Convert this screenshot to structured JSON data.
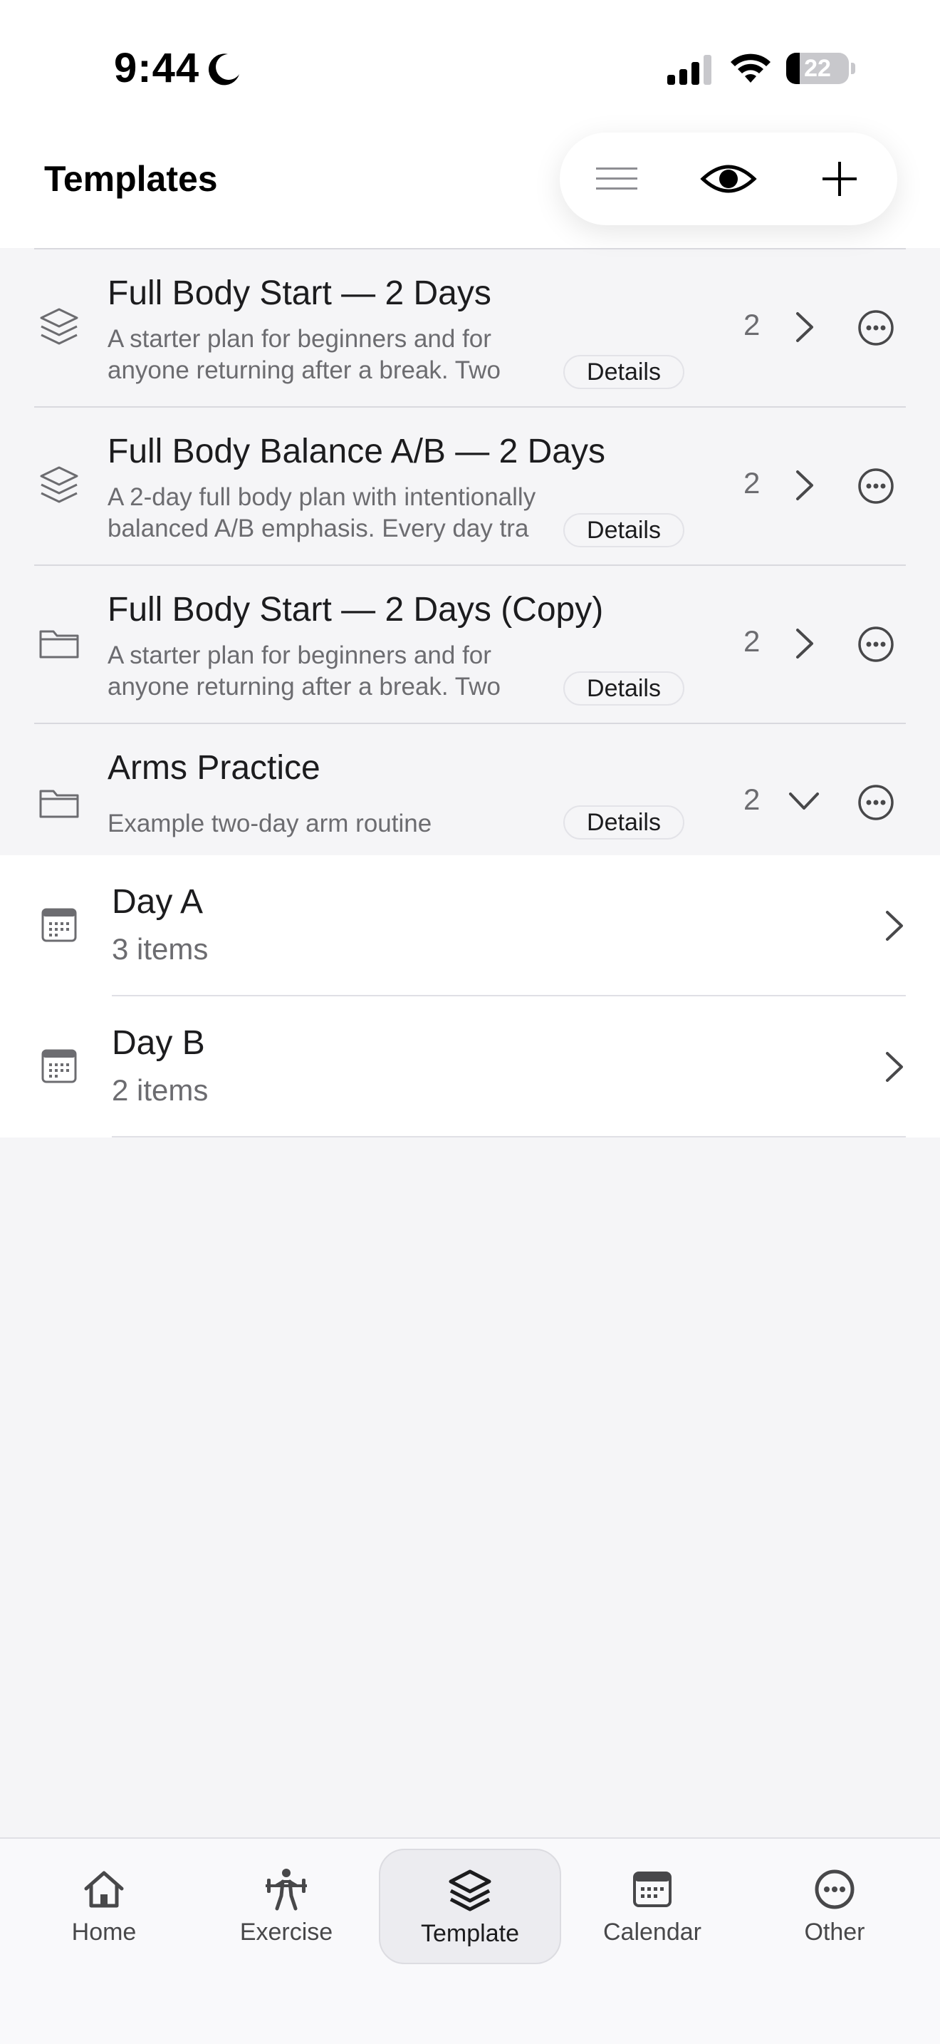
{
  "status": {
    "time": "9:44",
    "battery": "22",
    "battery_level": 0.22
  },
  "header": {
    "title": "Templates"
  },
  "toolbar": {
    "icons": [
      "list-icon",
      "eye-icon",
      "plus-icon"
    ]
  },
  "templates": [
    {
      "title": "Full Body Start — 2 Days",
      "description": "A starter plan for beginners and for anyone returning after a break. Two workouts",
      "details": "Details",
      "count": "2",
      "icon": "layers-icon",
      "expanded": false
    },
    {
      "title": "Full Body Balance A/B — 2 Days",
      "description": "A 2-day full body plan with intentionally balanced A/B emphasis. Every day tra",
      "details": "Details",
      "count": "2",
      "icon": "layers-icon",
      "expanded": false
    },
    {
      "title": "Full Body Start — 2 Days (Copy)",
      "description": "A starter plan for beginners and for anyone returning after a break. Two workouts",
      "details": "Details",
      "count": "2",
      "icon": "folder-icon",
      "expanded": false
    },
    {
      "title": "Arms Practice",
      "description": "Example two-day arm routine",
      "details": "Details",
      "count": "2",
      "icon": "folder-icon",
      "expanded": true
    }
  ],
  "days": [
    {
      "title": "Day A",
      "subtitle": "3 items"
    },
    {
      "title": "Day B",
      "subtitle": "2 items"
    }
  ],
  "tabs": [
    {
      "label": "Home",
      "icon": "home-icon",
      "active": false
    },
    {
      "label": "Exercise",
      "icon": "exercise-icon",
      "active": false
    },
    {
      "label": "Template",
      "icon": "layers-icon",
      "active": true
    },
    {
      "label": "Calendar",
      "icon": "calendar-icon",
      "active": false
    },
    {
      "label": "Other",
      "icon": "more-icon",
      "active": false
    }
  ],
  "colors": {
    "accent": "#1c1c1e",
    "background": "#f5f5f7",
    "secondary_text": "#6c6c70"
  }
}
